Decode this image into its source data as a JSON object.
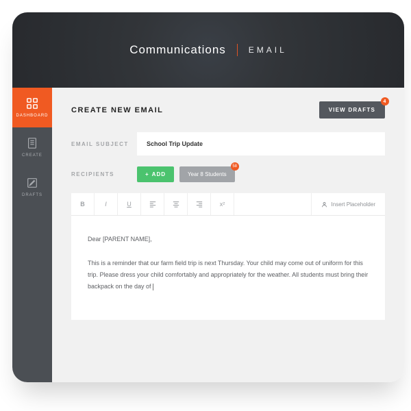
{
  "header": {
    "title": "Communications",
    "subtitle": "EMAIL"
  },
  "sidebar": {
    "items": [
      {
        "label": "DASHBOARD"
      },
      {
        "label": "CREATE"
      },
      {
        "label": "DRAFTS"
      }
    ]
  },
  "main": {
    "create_title": "CREATE NEW EMAIL",
    "view_drafts": {
      "label": "VIEW DRAFTS",
      "count": "4"
    },
    "subject": {
      "label": "EMAIL SUBJECT",
      "value": "School Trip Update"
    },
    "recipients": {
      "label": "RECIPIENTS",
      "add_label": "ADD",
      "chip": {
        "label": "Year 8 Students",
        "count": "58"
      }
    },
    "toolbar": {
      "bold": "B",
      "sup": "x²",
      "insert_placeholder": "Insert Placeholder"
    },
    "body": {
      "greeting": "Dear [PARENT NAME],",
      "paragraph": "This is a reminder that our farm field trip is next Thursday. Your child may come out of uniform for this trip. Please dress your child comfortably and appropriately for the weather. All students must bring their backpack on the day of"
    }
  }
}
